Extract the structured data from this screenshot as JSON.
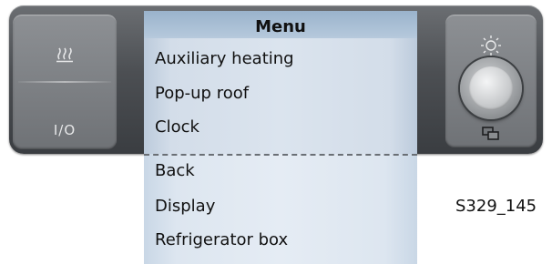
{
  "menu": {
    "title": "Menu",
    "items_visible": [
      "Auxiliary heating",
      "Pop-up roof",
      "Clock"
    ],
    "items_hidden": [
      "Back",
      "Display",
      "Refrigerator box"
    ]
  },
  "controls": {
    "power_label": "I/O"
  },
  "figure_code": "S329_145",
  "icons": {
    "heat": "heating-icon",
    "sun": "brightness-icon",
    "screens": "screens-icon"
  }
}
